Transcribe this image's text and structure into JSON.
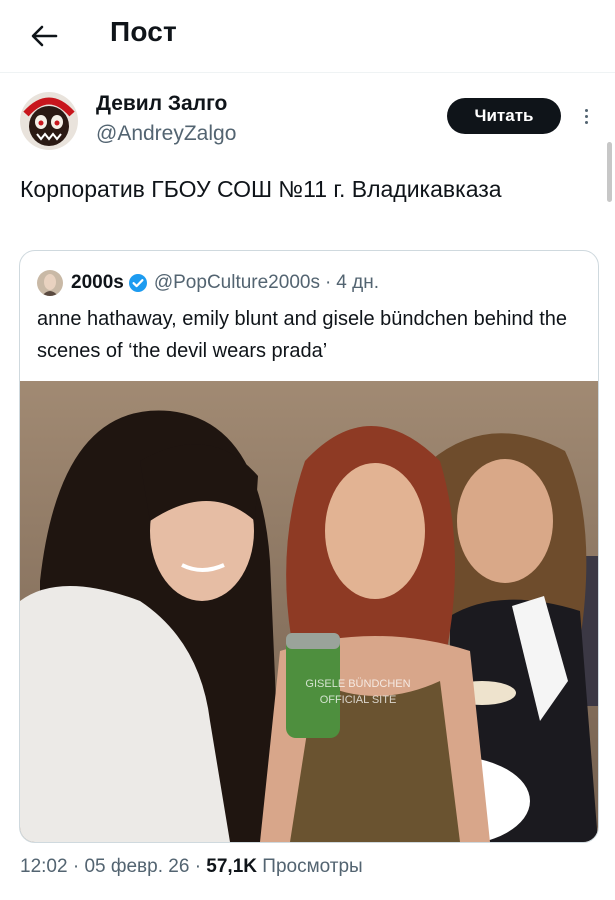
{
  "header": {
    "title": "Пост"
  },
  "author": {
    "name": "Девил Залго",
    "handle": "@AndreyZalgo",
    "follow_label": "Читать"
  },
  "post": {
    "text": "Корпоратив ГБОУ СОШ №11 г. Владикавказа"
  },
  "quote": {
    "name": "2000s",
    "handle": "@PopCulture2000s",
    "sep": "·",
    "time": "4 дн.",
    "text": "anne hathaway, emily blunt and gisele bündchen behind the scenes of ‘the devil wears prada’",
    "watermark_line1": "GISELE BÜNDCHEN",
    "watermark_line2": "OFFICIAL SITE"
  },
  "meta": {
    "time": "12:02",
    "sep1": "·",
    "date": "05 февр. 26",
    "sep2": "·",
    "views": "57,1K",
    "views_label": "Просмотры"
  },
  "colors": {
    "verified": "#1d9bf0",
    "text": "#0f1419",
    "secondary": "#536471",
    "follow_bg": "#0f1419"
  },
  "icons": {
    "back": "arrow-left-icon",
    "more": "more-vertical-icon",
    "verified": "verified-badge-icon"
  }
}
